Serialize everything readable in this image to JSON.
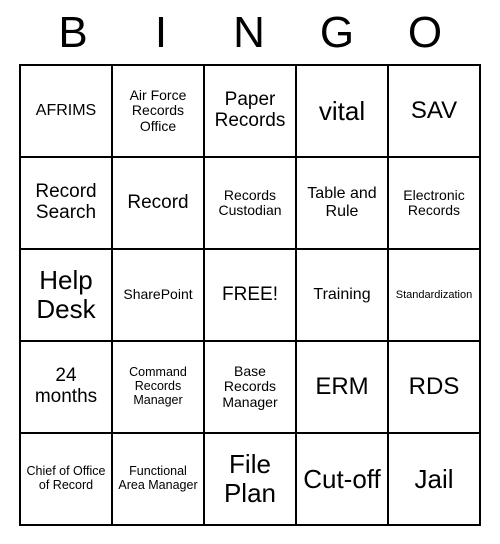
{
  "header": [
    "B",
    "I",
    "N",
    "G",
    "O"
  ],
  "grid": [
    [
      {
        "text": "AFRIMS",
        "size": "fs-sm"
      },
      {
        "text": "Air Force Records Office",
        "size": "fs-xs"
      },
      {
        "text": "Paper Records",
        "size": "fs-md"
      },
      {
        "text": "vital",
        "size": "fs-xxl"
      },
      {
        "text": "SAV",
        "size": "fs-xl"
      }
    ],
    [
      {
        "text": "Record Search",
        "size": "fs-md"
      },
      {
        "text": "Record",
        "size": "fs-md"
      },
      {
        "text": "Records Custodian",
        "size": "fs-xs"
      },
      {
        "text": "Table and Rule",
        "size": "fs-sm"
      },
      {
        "text": "Electronic Records",
        "size": "fs-xs"
      }
    ],
    [
      {
        "text": "Help Desk",
        "size": "fs-xxl"
      },
      {
        "text": "SharePoint",
        "size": "fs-xs"
      },
      {
        "text": "FREE!",
        "size": "fs-md"
      },
      {
        "text": "Training",
        "size": "fs-sm"
      },
      {
        "text": "Standardization",
        "size": "fs-tiny"
      }
    ],
    [
      {
        "text": "24 months",
        "size": "fs-md"
      },
      {
        "text": "Command Records Manager",
        "size": "fs-xxs"
      },
      {
        "text": "Base Records Manager",
        "size": "fs-xs"
      },
      {
        "text": "ERM",
        "size": "fs-xl"
      },
      {
        "text": "RDS",
        "size": "fs-xl"
      }
    ],
    [
      {
        "text": "Chief of Office of Record",
        "size": "fs-xxs"
      },
      {
        "text": "Functional Area Manager",
        "size": "fs-xxs"
      },
      {
        "text": "File Plan",
        "size": "fs-xxl"
      },
      {
        "text": "Cut-off",
        "size": "fs-xxl"
      },
      {
        "text": "Jail",
        "size": "fs-xxl"
      }
    ]
  ]
}
